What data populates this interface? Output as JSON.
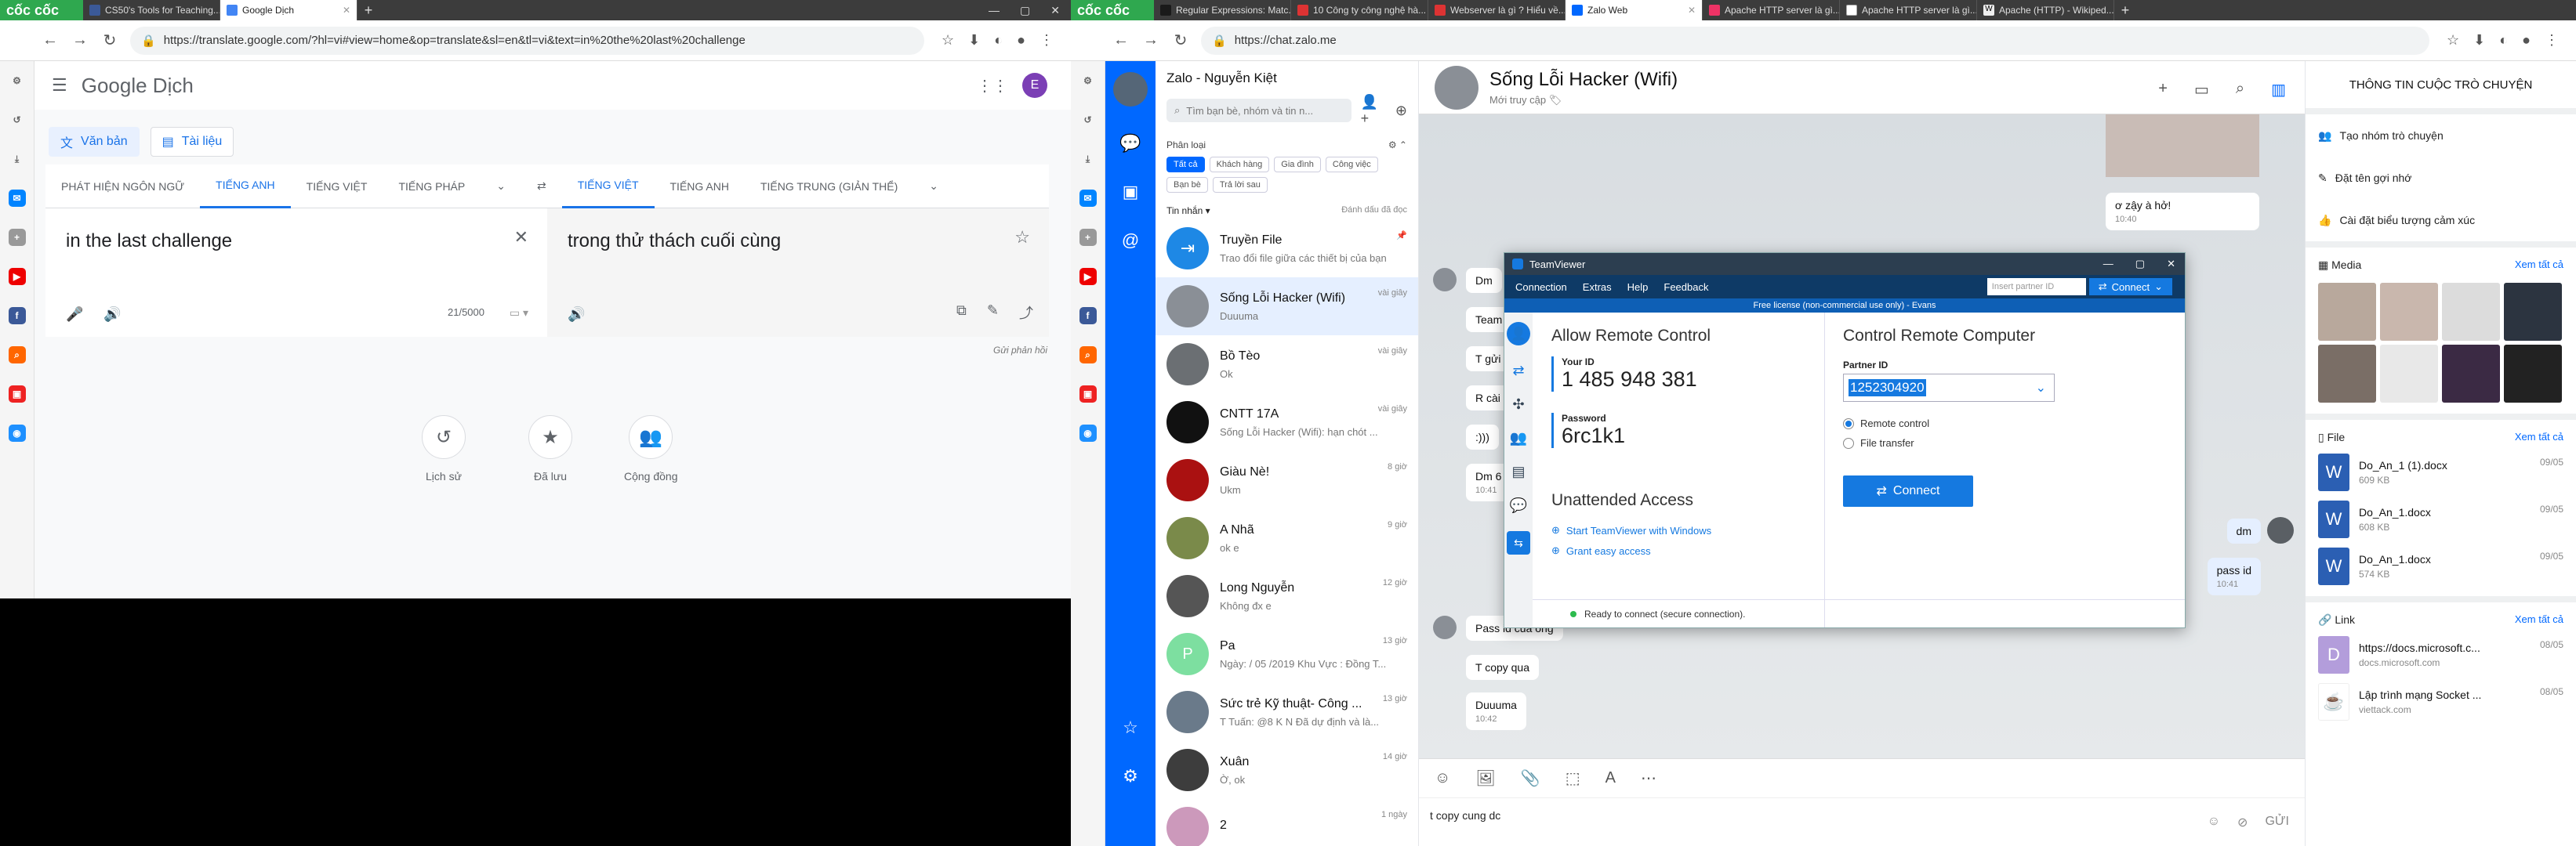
{
  "left_browser": {
    "logo": "cốc cốc",
    "tabs": [
      {
        "label": "CS50's Tools for Teaching...",
        "active": false
      },
      {
        "label": "Google Dịch",
        "active": true
      }
    ],
    "url": "https://translate.google.com/?hl=vi#view=home&op=translate&sl=en&tl=vi&text=in%20the%20last%20challenge",
    "gt": {
      "logo": "Google Dịch",
      "modes": [
        "Văn bản",
        "Tài liệu"
      ],
      "src_langs": [
        "PHÁT HIỆN NGÔN NGỮ",
        "TIẾNG ANH",
        "TIẾNG VIỆT",
        "TIẾNG PHÁP"
      ],
      "tgt_langs": [
        "TIẾNG VIỆT",
        "TIẾNG ANH",
        "TIẾNG TRUNG (GIẢN THỂ)"
      ],
      "source_text": "in the last challenge",
      "translated_text": "trong thử thách cuối cùng",
      "counter": "21/5000",
      "feedback": "Gửi phản hồi",
      "history": [
        "Lịch sử",
        "Đã lưu",
        "Cộng đồng"
      ]
    }
  },
  "right_browser": {
    "logo": "cốc cốc",
    "tabs": [
      {
        "label": "Regular Expressions: Matc...",
        "active": false
      },
      {
        "label": "10 Công ty công nghệ hà...",
        "active": false
      },
      {
        "label": "Webserver là gì ? Hiểu về...",
        "active": false
      },
      {
        "label": "Zalo Web",
        "active": true
      },
      {
        "label": "Apache HTTP server là gì...",
        "active": false
      },
      {
        "label": "Apache HTTP server là gì...",
        "active": false
      },
      {
        "label": "Apache (HTTP) - Wikiped...",
        "active": false
      }
    ],
    "url": "https://chat.zalo.me"
  },
  "zalo": {
    "title": "Zalo - Nguyễn Kiệt",
    "search_placeholder": "Tìm bạn bè, nhóm và tin n...",
    "filter_label": "Phân loại",
    "tags": [
      "Tất cả",
      "Khách hàng",
      "Gia đình",
      "Công việc",
      "Bạn bè",
      "Trả lời sau"
    ],
    "inbox_label": "Tin nhắn ▾",
    "mark_read": "Đánh dấu đã đọc",
    "conversations": [
      {
        "name": "Truyền File",
        "msg": "Trao đổi file giữa các thiết bị của bạn",
        "time": ""
      },
      {
        "name": "Sống Lỗi Hacker (Wifi)",
        "msg": "Duuuma",
        "time": "vài giây"
      },
      {
        "name": "Bồ Tèo",
        "msg": "Ok",
        "time": "vài giây"
      },
      {
        "name": "CNTT 17A",
        "msg": "Sống Lỗi Hacker (Wifi): hạn chót ...",
        "time": "vài giây"
      },
      {
        "name": "Giàu Nè!",
        "msg": "Ukm",
        "time": "8 giờ"
      },
      {
        "name": "A Nhã",
        "msg": "ok e",
        "time": "9 giờ"
      },
      {
        "name": "Long Nguyễn",
        "msg": "Không đx e",
        "time": "12 giờ"
      },
      {
        "name": "Pa",
        "msg": "Ngày: / 05 /2019 Khu Vực : Đồng T...",
        "time": "13 giờ"
      },
      {
        "name": "Sức trẻ Kỹ thuật- Công ...",
        "msg": "T Tuấn: @8 K N Đã dự định và là...",
        "time": "13 giờ"
      },
      {
        "name": "Xuân",
        "msg": "Ờ, ok",
        "time": "14 giờ"
      },
      {
        "name": "2",
        "msg": "",
        "time": "1 ngày"
      }
    ],
    "chat": {
      "name": "Sống Lỗi Hacker (Wifi)",
      "status": "Mới truy cập",
      "messages": {
        "m1": "ơ zậy à hở!",
        "m1t": "10:40",
        "left1": "Dm",
        "left2": "Team",
        "left3": "T gửi",
        "left4": "R cài",
        "left5": ":)))",
        "left6": "Dm 6",
        "left6t": "10:41",
        "me1": "dm",
        "me2": "pass id",
        "me2t": "10:41",
        "left7": "Pass id của ông",
        "left8": "T copy qua",
        "left9": "Duuuma",
        "left9t": "10:42"
      },
      "draft": "t copy cung dc",
      "send": "GỬI"
    },
    "info": {
      "title": "THÔNG TIN CUỘC TRÒ CHUYỆN",
      "actions": [
        "Tạo nhóm trò chuyện",
        "Đặt tên gợi nhớ",
        "Cài đặt biểu tượng cảm xúc"
      ],
      "media_label": "Media",
      "see_all": "Xem tất cả",
      "file_label": "File",
      "files": [
        {
          "name": "Do_An_1 (1).docx",
          "size": "609 KB",
          "date": "09/05"
        },
        {
          "name": "Do_An_1.docx",
          "size": "608 KB",
          "date": "09/05"
        },
        {
          "name": "Do_An_1.docx",
          "size": "574 KB",
          "date": "09/05"
        }
      ],
      "link_label": "Link",
      "links": [
        {
          "title": "https://docs.microsoft.c...",
          "domain": "docs.microsoft.com",
          "date": "08/05"
        },
        {
          "title": "Lập trình mạng Socket ...",
          "domain": "viettack.com",
          "date": "08/05"
        }
      ]
    }
  },
  "teamviewer": {
    "title": "TeamViewer",
    "menu": [
      "Connection",
      "Extras",
      "Help",
      "Feedback"
    ],
    "partner_placeholder": "Insert partner ID",
    "connect_small": "Connect",
    "license": "Free license (non-commercial use only) - Evans",
    "allow_title": "Allow Remote Control",
    "your_id_label": "Your ID",
    "your_id": "1 485 948 381",
    "password_label": "Password",
    "password": "6rc1k1",
    "unattended_title": "Unattended Access",
    "unattended_links": [
      "Start TeamViewer with Windows",
      "Grant easy access"
    ],
    "control_title": "Control Remote Computer",
    "partner_label": "Partner ID",
    "partner_id": "1252304920",
    "options": [
      "Remote control",
      "File transfer"
    ],
    "connect_btn": "Connect",
    "status": "Ready to connect (secure connection)."
  }
}
